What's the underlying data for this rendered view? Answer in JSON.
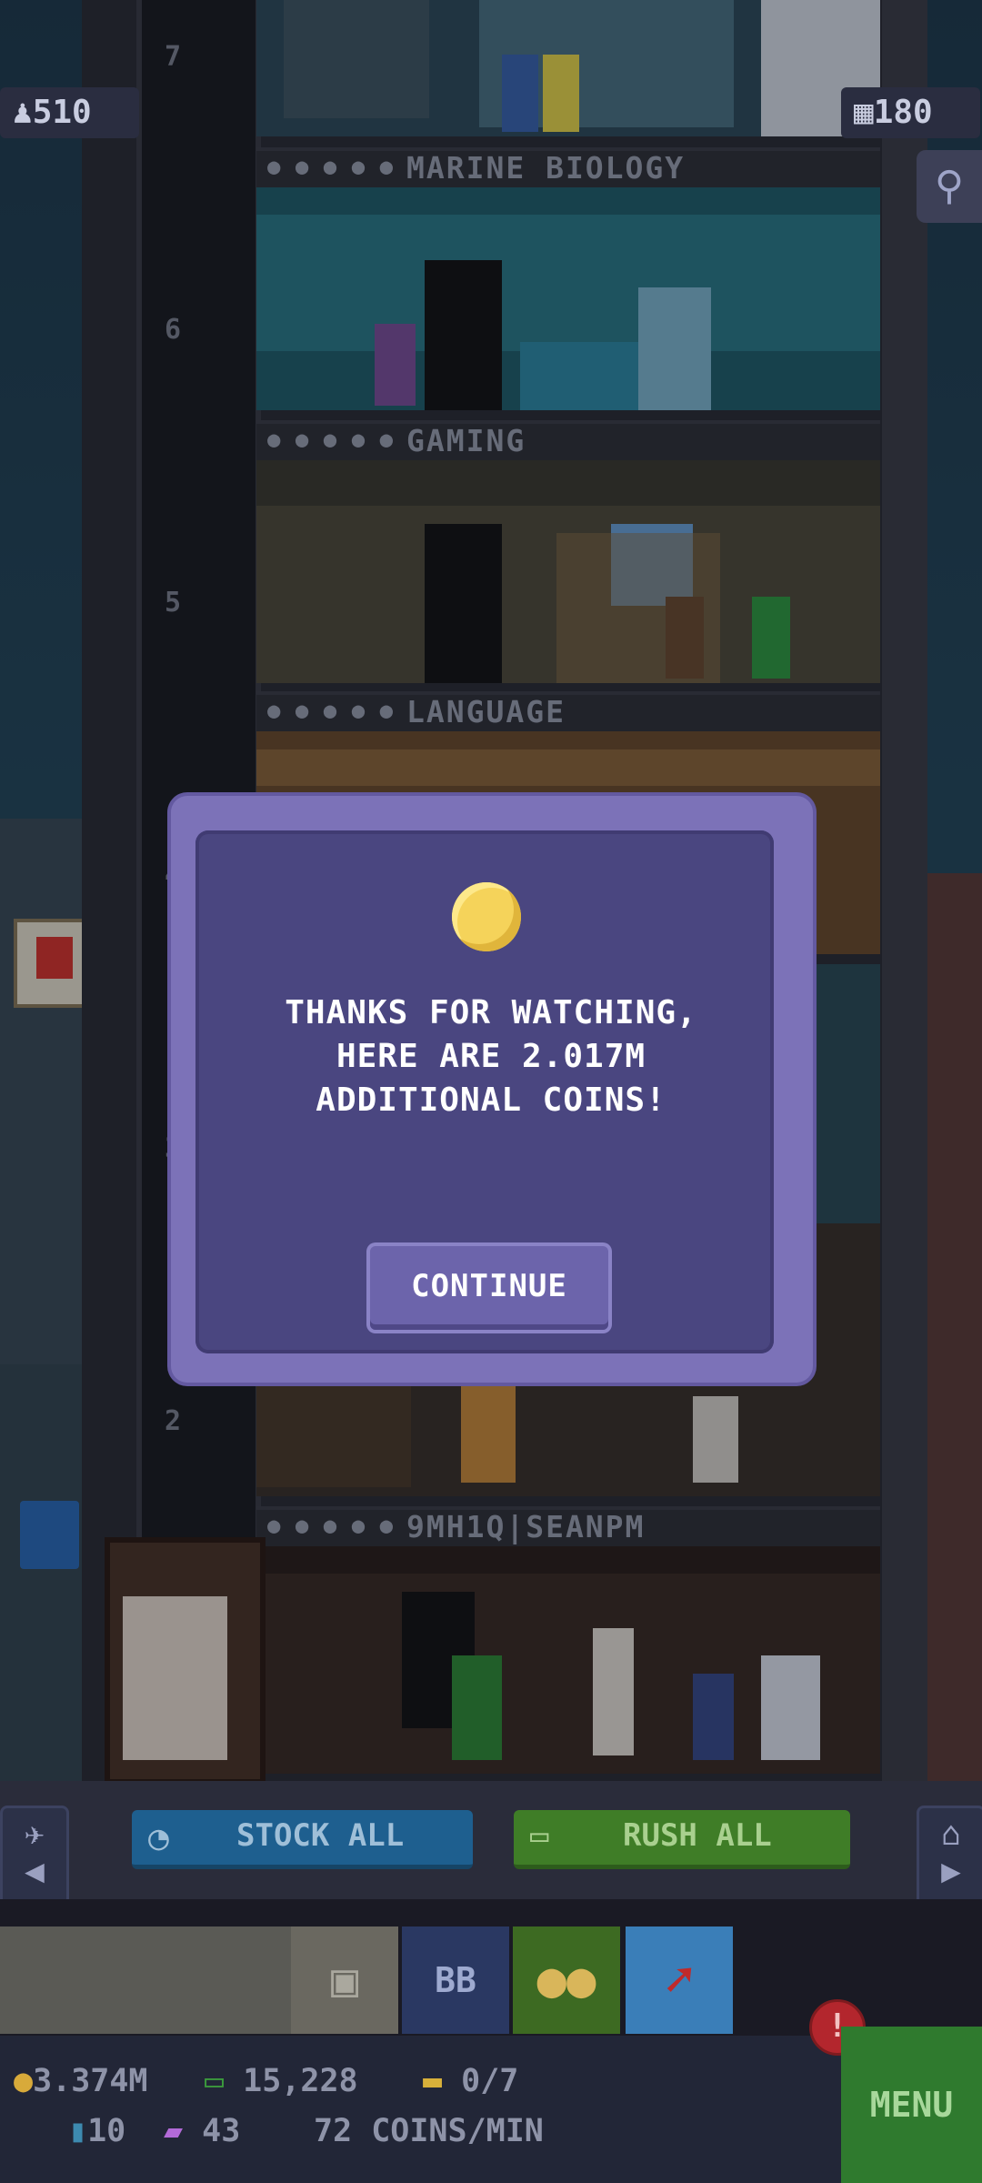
{
  "hud": {
    "population": "510",
    "floors_count": "180"
  },
  "floors": [
    {
      "number": "7",
      "name": "",
      "color": "#2d4a5a"
    },
    {
      "number": "6",
      "name": "MARINE BIOLOGY",
      "color": "#1f5f6a"
    },
    {
      "number": "5",
      "name": "GAMING",
      "color": "#3b3a2f"
    },
    {
      "number": "4",
      "name": "LANGUAGE",
      "color": "#6a4a2a"
    },
    {
      "number": "3",
      "name": "",
      "color": "#2a4a55"
    },
    {
      "number": "2",
      "name": "",
      "color": "#3a3028"
    },
    {
      "number": "",
      "name": "9MH1Q|SEANPM",
      "color": "#2a1e1a"
    }
  ],
  "modal": {
    "message_line1": "THANKS FOR WATCHING,",
    "message_line2": "HERE ARE 2.017M",
    "message_line3": "ADDITIONAL COINS!",
    "button_label": "CONTINUE"
  },
  "actions": {
    "stock_all": "STOCK ALL",
    "rush_all": "RUSH ALL"
  },
  "dock": {
    "bb_label": "BB"
  },
  "status": {
    "coins": "3.374M",
    "bux": "15,228",
    "tickets": "0/7",
    "bitizens": "10",
    "tv": "43",
    "rate": "72 COINS/MIN",
    "alert": "!"
  },
  "menu": {
    "label": "MENU"
  },
  "colors": {
    "modal_bg": "#4a4680",
    "modal_border": "#7c72b8",
    "stock_blue": "#1e5f8f",
    "rush_green": "#3f7d27",
    "menu_green": "#2f7a2e",
    "alert_red": "#b3262d"
  }
}
